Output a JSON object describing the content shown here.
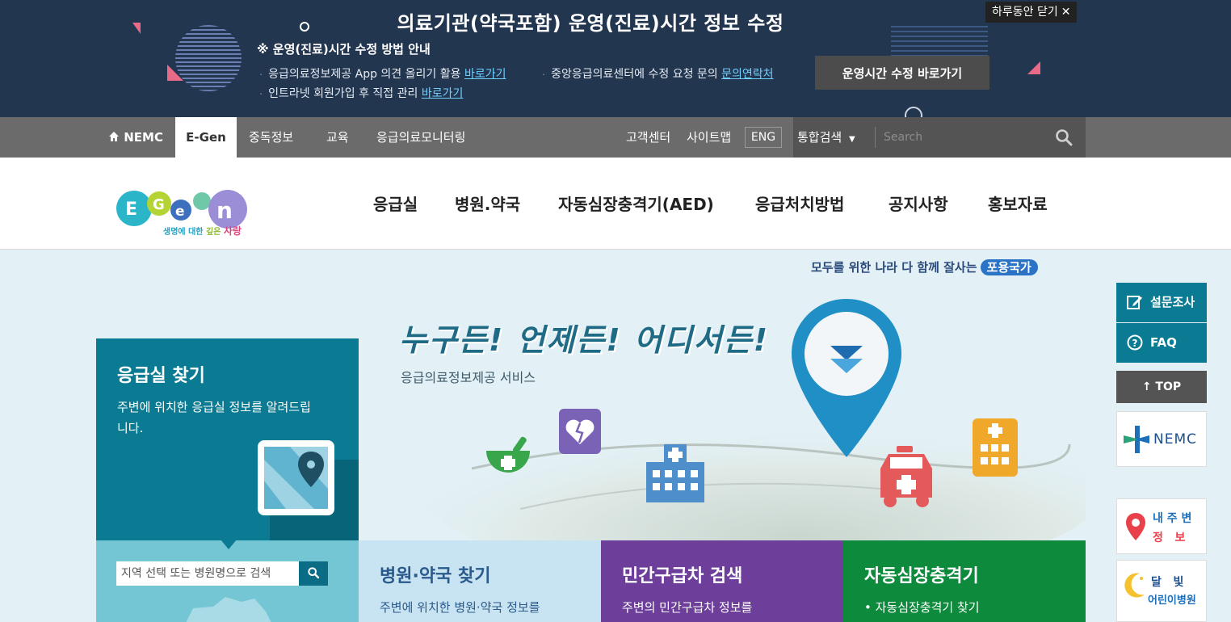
{
  "notice": {
    "title": "의료기관(약국포함) 운영(진료)시간 정보 수정",
    "subtitle": "※ 운영(진료)시간 수정 방법 안내",
    "line1_text": "응급의료정보제공 App 의견 올리기 활용",
    "line1_link": "바로가기",
    "line2_text": "인트라넷 회원가입 후 직접 관리",
    "line2_link": "바로가기",
    "line3_text": "중앙응급의료센터에 수정 요청 문의",
    "line3_link": "문의연락처",
    "go_button": "운영시간 수정 바로가기",
    "close_label": "하루동안 닫기",
    "close_icon": "close-icon"
  },
  "util_nav": {
    "home_label": "NEMC",
    "home_icon": "home-icon",
    "tabs": [
      "E-Gen",
      "중독정보",
      "교육",
      "응급의료모니터링"
    ],
    "links": [
      "고객센터",
      "사이트맵"
    ],
    "eng": "ENG",
    "search_type": "통합검색",
    "search_placeholder": "Search",
    "search_icon": "search-icon"
  },
  "header": {
    "logo_tagline_a": "생명에 대한",
    "logo_tagline_b": "깊은",
    "logo_tagline_c": "사랑",
    "menu": [
      "응급실",
      "병원.약국",
      "자동심장충격기(AED)",
      "응급처치방법",
      "공지사항",
      "홍보자료"
    ]
  },
  "visual": {
    "slogan_text": "모두를 위한 나라 다 함께 잘사는",
    "slogan_pill": "포용국가",
    "hero_title": "누구든! 언제든! 어디서든!",
    "hero_sub": "응급의료정보제공 서비스"
  },
  "er_card": {
    "title": "응급실 찾기",
    "desc": "주변에 위치한 응급실 정보를 알려드립니다.",
    "search_placeholder": "지역 선택 또는 병원명으로 검색",
    "map_icon": "map-pin-icon"
  },
  "tiles": [
    {
      "title": "병원·약국 찾기",
      "desc": "주변에 위치한 병원·약국 정보를",
      "bg": "#c8e3f1",
      "fg": "#2a5a8c"
    },
    {
      "title": "민간구급차 검색",
      "desc": "주변의 민간구급차 정보를",
      "bg": "#6d3f9b",
      "fg": "#ffffff"
    },
    {
      "title": "자동심장충격기",
      "desc": "• 자동심장충격기 찾기",
      "bg": "#0e8a3c",
      "fg": "#ffffff"
    }
  ],
  "quick_menu": {
    "survey": "설문조사",
    "faq": "FAQ",
    "top": "↑ TOP",
    "nemc": "NEMC",
    "mypos_a": "내 주 변",
    "mypos_b": "정   보",
    "moon_a": "달   빛",
    "moon_b": "어린이병원"
  },
  "colors": {
    "notice_bg": "#233650",
    "nav_bg": "#6b6b6b",
    "accent_teal": "#0a7b93",
    "link_blue": "#6fd0ff"
  }
}
